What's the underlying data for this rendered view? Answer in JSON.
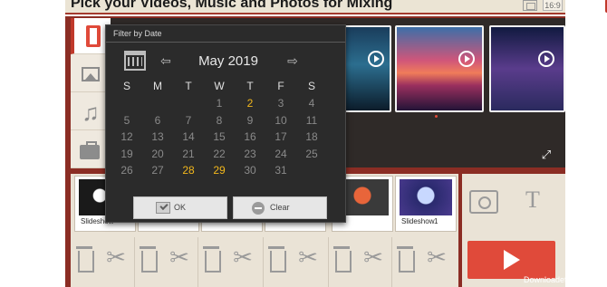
{
  "header": {
    "title": "Pick your Videos, Music and Photos for Mixing",
    "aspect_ratio": "16:9"
  },
  "sidebar": {
    "tabs": [
      {
        "icon": "film-icon",
        "active": true
      },
      {
        "icon": "photo-icon",
        "active": false
      },
      {
        "icon": "music-icon",
        "active": false
      },
      {
        "icon": "folder-icon",
        "active": false
      }
    ]
  },
  "media": {
    "thumbnails": [
      {
        "icon": "play-icon",
        "caption": ""
      },
      {
        "icon": "play-icon",
        "caption": ""
      },
      {
        "icon": "play-icon",
        "caption": ""
      }
    ]
  },
  "filter_dialog": {
    "title": "Filter by Date",
    "month_label": "May 2019",
    "weekdays": [
      "S",
      "M",
      "T",
      "W",
      "T",
      "F",
      "S"
    ],
    "weeks": [
      [
        "",
        "",
        "",
        "1",
        "2",
        "3",
        "4"
      ],
      [
        "5",
        "6",
        "7",
        "8",
        "9",
        "10",
        "11"
      ],
      [
        "12",
        "13",
        "14",
        "15",
        "16",
        "17",
        "18"
      ],
      [
        "19",
        "20",
        "21",
        "22",
        "23",
        "24",
        "25"
      ],
      [
        "26",
        "27",
        "28",
        "29",
        "30",
        "31",
        ""
      ]
    ],
    "highlighted_days": [
      "2",
      "28",
      "29"
    ],
    "ok_label": "OK",
    "clear_label": "Clear"
  },
  "timeline": {
    "slots": [
      {
        "label": "Slideshow",
        "number": ""
      },
      {
        "label": "",
        "number": ""
      },
      {
        "label": "",
        "number": ""
      },
      {
        "label": "",
        "number": ""
      },
      {
        "label": "",
        "number": ""
      },
      {
        "label": "Slideshow",
        "number": "1"
      }
    ]
  },
  "watermark": "Downloadefilm.ir",
  "colors": {
    "accent": "#e04a3a",
    "frame": "#8b2d24",
    "highlight_day": "#f2b71c",
    "dialog_bg": "#2b2b2b"
  }
}
